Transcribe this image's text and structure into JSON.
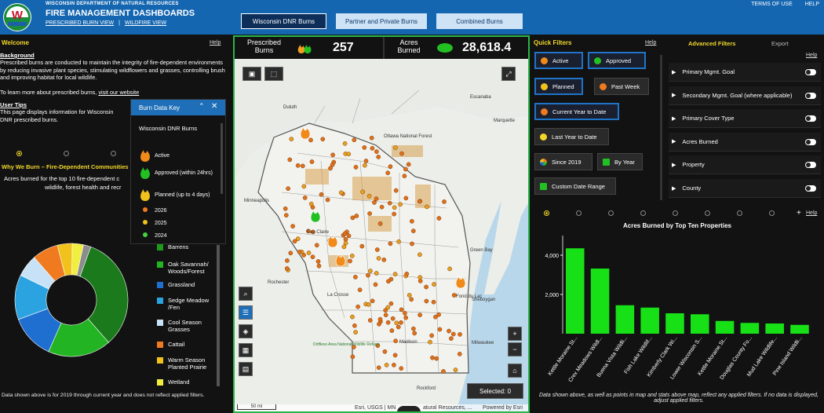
{
  "topbar": {
    "agency": "WISCONSIN DEPARTMENT OF NATURAL RESOURCES",
    "title": "FIRE MANAGEMENT DASHBOARDS",
    "view_a": "PRESCRIBED BURN VIEW",
    "sep": "|",
    "view_b": "WILDFIRE VIEW",
    "btn1": "Wisconsin DNR Burns",
    "btn2": "Partner and Private Burns",
    "btn3": "Combined Burns",
    "terms": "TERMS OF USE",
    "help": "HELP"
  },
  "welcome": {
    "title": "Welcome",
    "help": "Help",
    "bg_head": "Background",
    "bg_text": "Prescribed burns are conducted to maintain the integrity of fire-dependent environments by reducing invasive plant species, stimulating wildflowers and grasses, controlling brush and improving habitat for local wildlife.",
    "learn_text": "To learn more about prescribed burns,",
    "learn_link": "visit our website",
    "tips_head": "User Tips",
    "tips_text": "This page displays information for Wisconsin DNR prescribed burns."
  },
  "why": {
    "title": "Why We Burn – Fire-Dependent Communities",
    "subtitle_a": "Acres burned for the top 10 fire-dependent c",
    "subtitle_b": "wildlife, forest health and recr",
    "footer": "Data shown above is for 2019 through current year and does not reflect applied filters."
  },
  "donut": {
    "colors": [
      "#1b7a1b",
      "#22b422",
      "#1f6fd0",
      "#2aa3e0",
      "#c7e2f7",
      "#f07a1f",
      "#f2c21c",
      "#f0ef3f",
      "#8c8c8c"
    ],
    "values": [
      31,
      17,
      12,
      12,
      6,
      7,
      4,
      3,
      2
    ]
  },
  "communities": [
    {
      "label": "Barrens",
      "color": "#1b9a1b"
    },
    {
      "label": "Oak Savannah/ Woods/Forest",
      "color": "#22b422"
    },
    {
      "label": "Grassland",
      "color": "#1f6fd0"
    },
    {
      "label": "Sedge Meadow /Fen",
      "color": "#2aa3e0"
    },
    {
      "label": "Cool Season Grasses",
      "color": "#c7e2f7"
    },
    {
      "label": "Cattail",
      "color": "#f07a1f"
    },
    {
      "label": "Warm Season Planted Prairie",
      "color": "#f2c21c"
    },
    {
      "label": "Wetland",
      "color": "#f0ef3f"
    }
  ],
  "stats": {
    "pb_label": "Prescribed Burns",
    "pb_value": "257",
    "ab_label": "Acres Burned",
    "ab_value": "28,618.4"
  },
  "datakey": {
    "title": "Burn Data Key",
    "subtitle": "Wisconsin DNR Burns",
    "items": [
      {
        "label": "Active"
      },
      {
        "label": "Approved (within 24hrs)"
      },
      {
        "label": "Planned (up to 4 days)"
      },
      {
        "label": "2026",
        "color": "#f07a1f"
      },
      {
        "label": "2025",
        "color": "#f2c21c"
      },
      {
        "label": "2024",
        "color": "#44d044"
      }
    ]
  },
  "map": {
    "labels": [
      "Duluth",
      "Marquette",
      "Ottawa National Forest",
      "Minneapolis",
      "Eau Claire",
      "Green Bay",
      "Rochester",
      "Sheboygan",
      "Madison",
      "Milwaukee",
      "Rockford",
      "Fond du Lac",
      "La Crosse",
      "Driftless Area National Wildlife Refuge",
      "Escanaba"
    ],
    "selected": "Selected: 0",
    "attribution": "Esri, USGS | MN",
    "attribution2": "atural Resources, ...",
    "powered": "Powered by Esri",
    "scale": "50 mi"
  },
  "quick": {
    "title": "Quick Filters",
    "help": "Help",
    "buttons": [
      "Active",
      "Approved",
      "Planned",
      "Past Week",
      "Current Year to Date",
      "Last Year to Date",
      "Since 2019",
      "By Year",
      "Custom Date Range"
    ]
  },
  "advanced": {
    "tab1": "Advanced Filters",
    "tab2": "Export",
    "help": "Help",
    "rows": [
      "Primary Mgmt. Goal",
      "Secondary Mgmt. Goal (where applicable)",
      "Primary Cover Type",
      "Acres Burned",
      "Property",
      "County"
    ]
  },
  "bars_panel": {
    "help": "Help",
    "plus": "+",
    "footer": "Data shown above, as well as points in map and stats above map, reflect any applied filters. If no data is displayed, adjust applied filters."
  },
  "chart_data": {
    "type": "bar",
    "title": "Acres Burned by Top Ten Properties",
    "categories": [
      "Kettle Moraine St...",
      "Crex Meadows Wildl...",
      "Buena Vista Wildli...",
      "Fish Lake Wildlif...",
      "Kimberly Clark Wi...",
      "Lower Wisconsin S...",
      "Kettle Moraine St...",
      "Douglas County Fo...",
      "Mud Lake Wildlife...",
      "Pine Island Wildli..."
    ],
    "values": [
      4350,
      3320,
      1450,
      1330,
      1040,
      990,
      650,
      550,
      520,
      450
    ],
    "ylim": [
      0,
      4600
    ],
    "yticks": [
      "2,000",
      "4,000"
    ],
    "color": "#17e017"
  }
}
